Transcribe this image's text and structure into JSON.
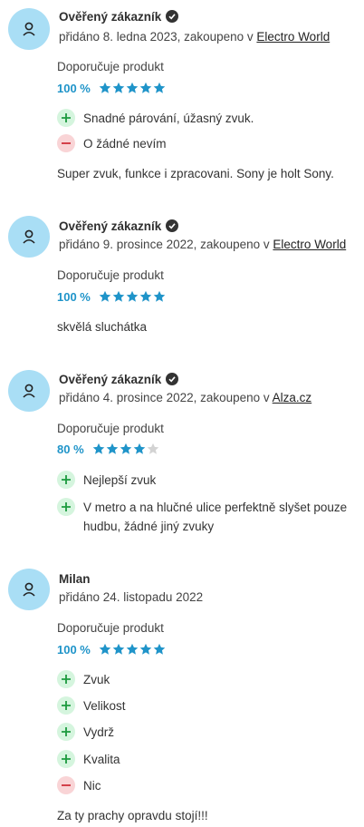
{
  "reviews": [
    {
      "author": "Ověřený zákazník",
      "verified": true,
      "added_prefix": "přidáno 8. ledna 2023, zakoupeno v ",
      "store": "Electro World",
      "recommends": "Doporučuje produkt",
      "percent": "100 %",
      "stars": 5,
      "pros": [
        "Snadné párování, úžasný zvuk."
      ],
      "cons": [
        "O žádné nevím"
      ],
      "text": "Super zvuk, funkce i zpracovani. Sony je holt Sony."
    },
    {
      "author": "Ověřený zákazník",
      "verified": true,
      "added_prefix": "přidáno 9. prosince 2022, zakoupeno v ",
      "store": "Electro World",
      "recommends": "Doporučuje produkt",
      "percent": "100 %",
      "stars": 5,
      "pros": [],
      "cons": [],
      "text": "skvělá sluchátka"
    },
    {
      "author": "Ověřený zákazník",
      "verified": true,
      "added_prefix": "přidáno 4. prosince 2022, zakoupeno v ",
      "store": "Alza.cz",
      "recommends": "Doporučuje produkt",
      "percent": "80 %",
      "stars": 4,
      "pros": [
        "Nejlepší zvuk",
        "V metro a na hlučné ulice perfektně slyšet pouze hudbu, žádné jiný zvuky"
      ],
      "cons": [],
      "text": ""
    },
    {
      "author": "Milan",
      "verified": false,
      "added_prefix": "přidáno 24. listopadu 2022",
      "store": "",
      "recommends": "Doporučuje produkt",
      "percent": "100 %",
      "stars": 5,
      "pros": [
        "Zvuk",
        "Velikost",
        "Vydrž",
        "Kvalita"
      ],
      "cons": [
        "Nic"
      ],
      "text": "Za ty prachy opravdu stojí!!!"
    }
  ],
  "colors": {
    "star_filled": "#1f94c9",
    "star_empty": "#d3d3d3",
    "plus_bg": "#d5f5de",
    "plus_fg": "#1c9a3e",
    "minus_bg": "#f9d4d6",
    "minus_fg": "#d0303a",
    "avatar_bg": "#a9def5"
  },
  "icons": {
    "avatar": "user-icon",
    "verified": "check-badge-icon",
    "pro": "plus-icon",
    "con": "minus-icon",
    "star": "star-icon"
  }
}
